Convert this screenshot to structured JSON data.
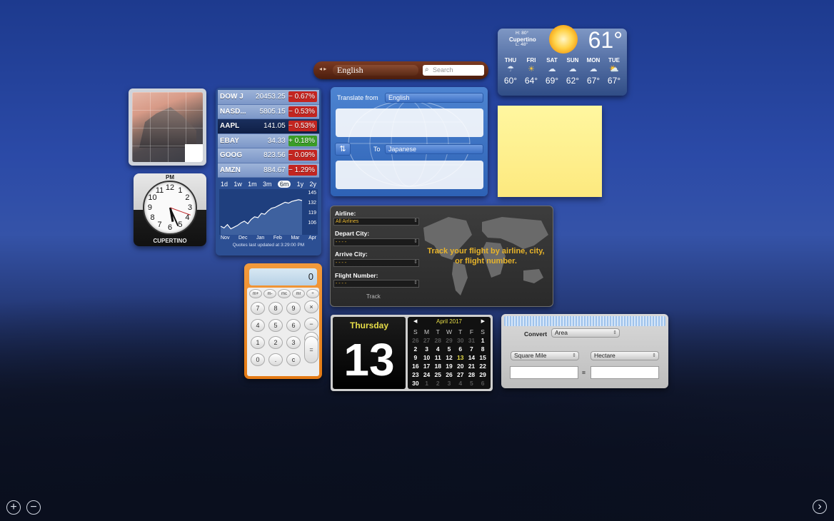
{
  "translator_bar": {
    "language": "English",
    "search_placeholder": "Search"
  },
  "weather": {
    "hi": "H: 80°",
    "lo": "L: 48°",
    "city": "Cupertino",
    "temp": "61°",
    "days": [
      {
        "name": "THU",
        "icon": "rain-icon",
        "glyph": "☂",
        "temp": "60°"
      },
      {
        "name": "FRI",
        "icon": "sun-icon",
        "glyph": "☀",
        "temp": "64°"
      },
      {
        "name": "SAT",
        "icon": "cloud-icon",
        "glyph": "☁",
        "temp": "69°"
      },
      {
        "name": "SUN",
        "icon": "cloud-icon",
        "glyph": "☁",
        "temp": "62°"
      },
      {
        "name": "MON",
        "icon": "cloud-icon",
        "glyph": "☁",
        "temp": "67°"
      },
      {
        "name": "TUE",
        "icon": "partly-sunny-icon",
        "glyph": "⛅",
        "temp": "67°"
      }
    ]
  },
  "stocks": {
    "rows": [
      {
        "symbol": "DOW J",
        "price": "20453.25",
        "change": "− 0.67%",
        "dir": "neg"
      },
      {
        "symbol": "NASD...",
        "price": "5805.15",
        "change": "− 0.53%",
        "dir": "neg"
      },
      {
        "symbol": "AAPL",
        "price": "141.05",
        "change": "− 0.53%",
        "dir": "neg"
      },
      {
        "symbol": "EBAY",
        "price": "34.33",
        "change": "+ 0.18%",
        "dir": "pos"
      },
      {
        "symbol": "GOOG",
        "price": "823.56",
        "change": "− 0.09%",
        "dir": "neg"
      },
      {
        "symbol": "AMZN",
        "price": "884.67",
        "change": "− 1.29%",
        "dir": "neg"
      }
    ],
    "ranges": [
      "1d",
      "1w",
      "1m",
      "3m",
      "6m",
      "1y",
      "2y"
    ],
    "active_range": "6m",
    "chart": {
      "ylabels": [
        "145",
        "132",
        "119",
        "106"
      ],
      "xlabels": [
        "Nov",
        "Dec",
        "Jan",
        "Feb",
        "Mar",
        "Apr"
      ],
      "values": [
        110,
        108,
        112,
        107,
        109,
        111,
        114,
        116,
        113,
        118,
        121,
        120,
        125,
        124,
        128,
        131,
        132,
        134,
        136,
        138,
        137,
        139,
        140,
        141,
        140
      ]
    },
    "footer": "Quotes last updated at 3:29:00 PM"
  },
  "translate": {
    "from_label": "Translate from",
    "from_lang": "English",
    "to_label": "To",
    "to_lang": "Japanese"
  },
  "flight": {
    "airline_label": "Airline:",
    "airline_value": "All Airlines",
    "depart_label": "Depart City:",
    "depart_value": "- - - -",
    "arrive_label": "Arrive City:",
    "arrive_value": "- - - -",
    "number_label": "Flight Number:",
    "number_value": "- - - -",
    "track_label": "Track",
    "message": "Track your flight by airline, city, or flight number."
  },
  "clock": {
    "ampm": "PM",
    "city": "CUPERTINO"
  },
  "calculator": {
    "display": "0",
    "mem_keys": [
      "m+",
      "m-",
      "mc",
      "mr",
      "÷"
    ],
    "rows": [
      [
        "7",
        "8",
        "9",
        "×"
      ],
      [
        "4",
        "5",
        "6",
        "−"
      ],
      [
        "1",
        "2",
        "3",
        "+"
      ],
      [
        "0",
        ".",
        "c",
        "="
      ]
    ]
  },
  "calendar": {
    "day_name": "Thursday",
    "day_number": "13",
    "month": "April 2017",
    "weekdays": [
      "S",
      "M",
      "T",
      "W",
      "T",
      "F",
      "S"
    ],
    "cells": [
      {
        "d": "26",
        "m": "dim"
      },
      {
        "d": "27",
        "m": "dim"
      },
      {
        "d": "28",
        "m": "dim"
      },
      {
        "d": "29",
        "m": "dim"
      },
      {
        "d": "30",
        "m": "dim"
      },
      {
        "d": "31",
        "m": "dim"
      },
      {
        "d": "1",
        "m": ""
      },
      {
        "d": "2",
        "m": ""
      },
      {
        "d": "3",
        "m": ""
      },
      {
        "d": "4",
        "m": ""
      },
      {
        "d": "5",
        "m": ""
      },
      {
        "d": "6",
        "m": ""
      },
      {
        "d": "7",
        "m": ""
      },
      {
        "d": "8",
        "m": ""
      },
      {
        "d": "9",
        "m": ""
      },
      {
        "d": "10",
        "m": ""
      },
      {
        "d": "11",
        "m": ""
      },
      {
        "d": "12",
        "m": ""
      },
      {
        "d": "13",
        "m": "today"
      },
      {
        "d": "14",
        "m": ""
      },
      {
        "d": "15",
        "m": ""
      },
      {
        "d": "16",
        "m": ""
      },
      {
        "d": "17",
        "m": ""
      },
      {
        "d": "18",
        "m": ""
      },
      {
        "d": "19",
        "m": ""
      },
      {
        "d": "20",
        "m": ""
      },
      {
        "d": "21",
        "m": ""
      },
      {
        "d": "22",
        "m": ""
      },
      {
        "d": "23",
        "m": ""
      },
      {
        "d": "24",
        "m": ""
      },
      {
        "d": "25",
        "m": ""
      },
      {
        "d": "26",
        "m": ""
      },
      {
        "d": "27",
        "m": ""
      },
      {
        "d": "28",
        "m": ""
      },
      {
        "d": "29",
        "m": ""
      },
      {
        "d": "30",
        "m": ""
      },
      {
        "d": "1",
        "m": "dim"
      },
      {
        "d": "2",
        "m": "dim"
      },
      {
        "d": "3",
        "m": "dim"
      },
      {
        "d": "4",
        "m": "dim"
      },
      {
        "d": "5",
        "m": "dim"
      },
      {
        "d": "6",
        "m": "dim"
      }
    ]
  },
  "converter": {
    "convert_label": "Convert",
    "category": "Area",
    "from_unit": "Square Mile",
    "to_unit": "Hectare",
    "equals": "="
  },
  "controls": {
    "add": "+",
    "remove": "−",
    "next": "›"
  }
}
